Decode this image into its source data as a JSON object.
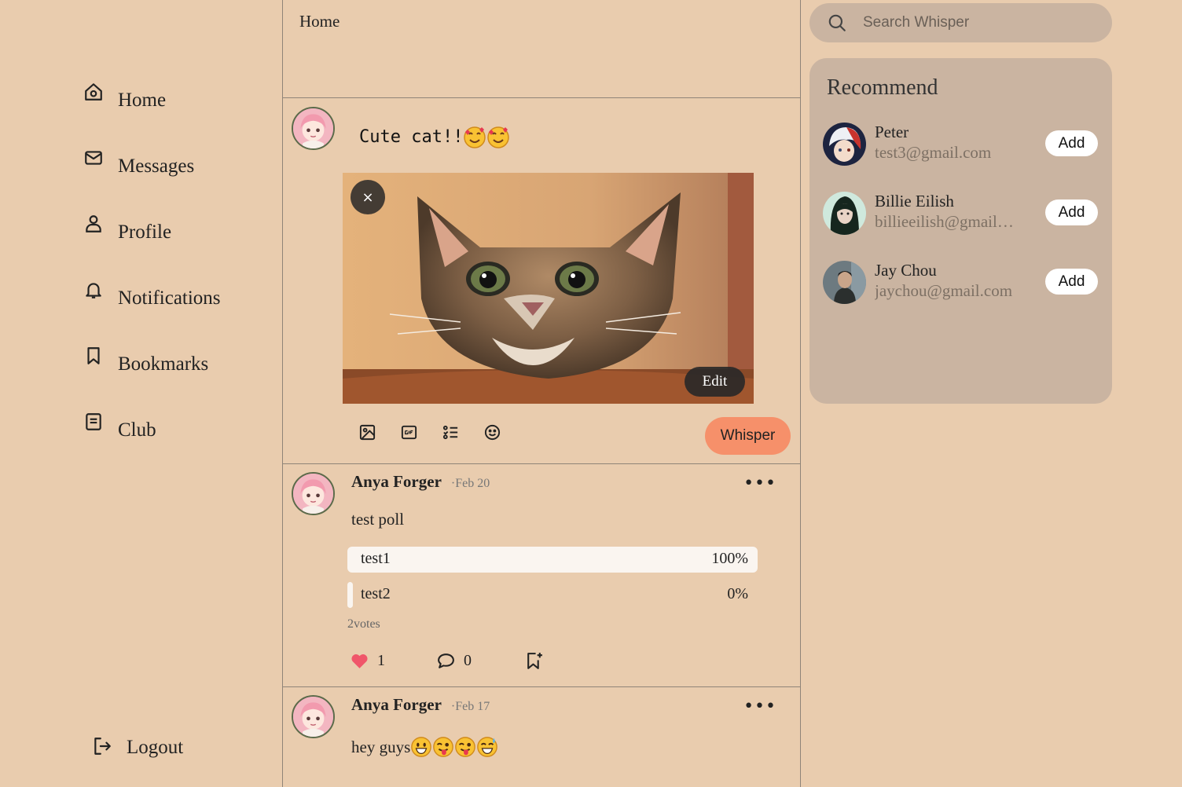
{
  "sidebar": {
    "items": [
      {
        "label": "Home",
        "icon": "home-icon"
      },
      {
        "label": "Messages",
        "icon": "mail-icon"
      },
      {
        "label": "Profile",
        "icon": "user-icon"
      },
      {
        "label": "Notifications",
        "icon": "bell-icon"
      },
      {
        "label": "Bookmarks",
        "icon": "bookmark-icon"
      },
      {
        "label": "Club",
        "icon": "document-icon"
      }
    ],
    "logout": "Logout"
  },
  "main": {
    "title": "Home",
    "composer": {
      "text": "Cute cat!!",
      "emojis": [
        "smiling-face-with-hearts",
        "smiling-face-with-hearts"
      ],
      "edit_label": "Edit",
      "close_label": "×",
      "submit_label": "Whisper"
    },
    "posts": [
      {
        "author": "Anya Forger",
        "date": "·Feb 20",
        "text": "test poll",
        "poll": {
          "options": [
            {
              "name": "test1",
              "percent": "100%",
              "fraction": 1.0
            },
            {
              "name": "test2",
              "percent": "0%",
              "fraction": 0.0
            }
          ],
          "votes": "2votes"
        },
        "likes": "1",
        "comments": "0"
      },
      {
        "author": "Anya Forger",
        "date": "·Feb 17",
        "text": "hey guys",
        "emojis": [
          "grinning",
          "winking-tongue",
          "winking-tongue",
          "grinning-sweat"
        ]
      }
    ]
  },
  "search": {
    "placeholder": "Search Whisper"
  },
  "recommend": {
    "title": "Recommend",
    "users": [
      {
        "name": "Peter",
        "email": "test3@gmail.com",
        "add_label": "Add"
      },
      {
        "name": "Billie Eilish",
        "email": "billieeilish@gmail.com",
        "add_label": "Add"
      },
      {
        "name": "Jay Chou",
        "email": "jaychou@gmail.com",
        "add_label": "Add"
      }
    ]
  },
  "colors": {
    "background": "#e9ccae",
    "panel": "#cab4a1",
    "accent": "#f6906a",
    "like": "#f0566a"
  }
}
